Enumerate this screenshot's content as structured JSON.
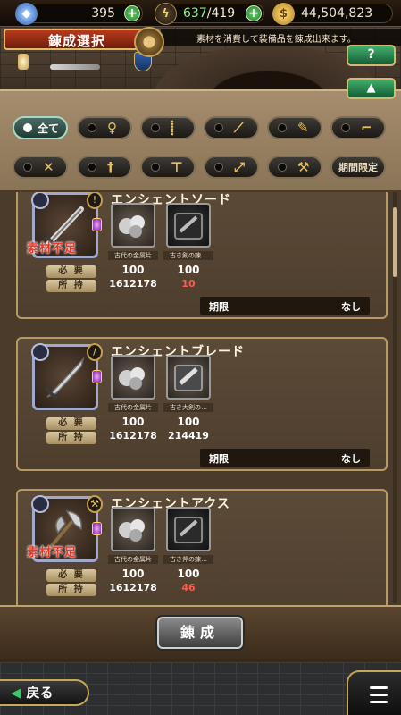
{
  "resources": {
    "gems": "395",
    "stamina": "637",
    "stamina_max": "/419",
    "gold": "44,504,823"
  },
  "header": {
    "title": "錬成選択",
    "info": "素材を消費して装備品を錬成出来ます。",
    "help_label": "?",
    "collapse_label": "▲"
  },
  "filters": [
    {
      "label": "全て",
      "glyph": "",
      "active": true
    },
    {
      "label": "",
      "glyph": "♀",
      "active": false
    },
    {
      "label": "",
      "glyph": "⸽",
      "active": false
    },
    {
      "label": "",
      "glyph": "⟋",
      "active": false
    },
    {
      "label": "",
      "glyph": "✎",
      "active": false
    },
    {
      "label": "",
      "glyph": "⌐",
      "active": false
    },
    {
      "label": "",
      "glyph": "✕",
      "active": false
    },
    {
      "label": "",
      "glyph": "†",
      "active": false
    },
    {
      "label": "",
      "glyph": "⊤",
      "active": false
    },
    {
      "label": "",
      "glyph": "⤢",
      "active": false
    },
    {
      "label": "",
      "glyph": "⚒",
      "active": false
    },
    {
      "label": "期間限定",
      "glyph": "",
      "active": false
    }
  ],
  "labels": {
    "shortage": "素材不足",
    "required": "必 要",
    "owned": "所 持",
    "expiry": "期限",
    "expiry_none": "なし"
  },
  "items": [
    {
      "name": "エンシェントソード",
      "shortage": true,
      "materials": [
        {
          "name": "古代の金属片",
          "need": "100",
          "have": "1612178",
          "insufficient": false
        },
        {
          "name": "古き剣の錬…",
          "need": "100",
          "have": "10",
          "insufficient": true
        }
      ]
    },
    {
      "name": "エンシェントブレード",
      "shortage": false,
      "materials": [
        {
          "name": "古代の金属片",
          "need": "100",
          "have": "1612178",
          "insufficient": false
        },
        {
          "name": "古き大剣の…",
          "need": "100",
          "have": "214419",
          "insufficient": false
        }
      ]
    },
    {
      "name": "エンシェントアクス",
      "shortage": true,
      "materials": [
        {
          "name": "古代の金属片",
          "need": "100",
          "have": "1612178",
          "insufficient": false
        },
        {
          "name": "古き斧の錬…",
          "need": "100",
          "have": "46",
          "insufficient": true
        }
      ]
    }
  ],
  "actions": {
    "forge_label": "錬成",
    "back_label": "戻る"
  },
  "colors": {
    "accent_gold": "#c9a55a",
    "shortage_red": "#e43b2b",
    "green_button": "#2e8f52"
  }
}
